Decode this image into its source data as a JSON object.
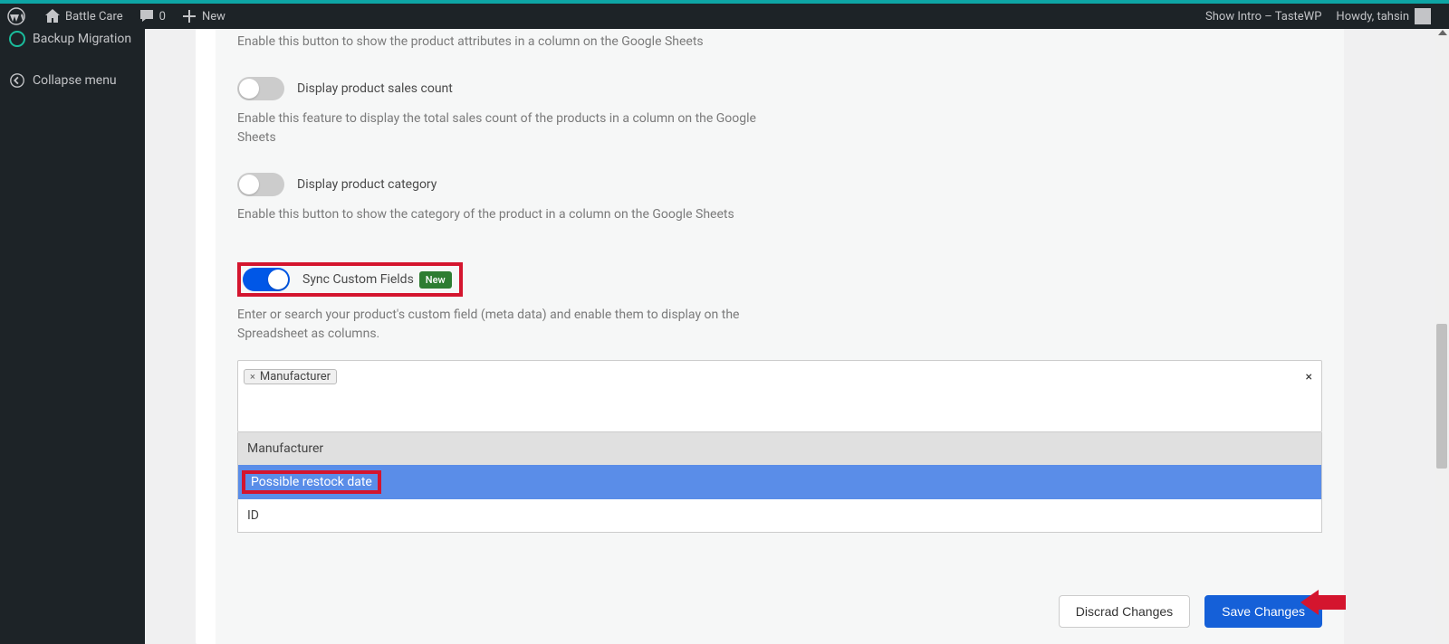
{
  "toolbar": {
    "site_name": "Battle Care",
    "comments_count": "0",
    "new_label": "New",
    "intro_link": "Show Intro – TasteWP",
    "howdy": "Howdy, tahsin"
  },
  "sidebar": {
    "backup_migration": "Backup Migration",
    "collapse": "Collapse menu"
  },
  "settings": {
    "attributes": {
      "desc": "Enable this button to show the product attributes in a column on the Google Sheets"
    },
    "sales_count": {
      "label": "Display product sales count",
      "desc": "Enable this feature to display the total sales count of the products in a column on the Google Sheets"
    },
    "category": {
      "label": "Display product category",
      "desc": "Enable this button to show the category of the product in a column on the Google Sheets"
    },
    "custom_fields": {
      "label": "Sync Custom Fields",
      "badge": "New",
      "desc": "Enter or search your product's custom field (meta data) and enable them to display on the Spreadsheet as columns."
    }
  },
  "multiselect": {
    "selected_tag": "Manufacturer",
    "options": [
      "Manufacturer",
      "Possible restock date",
      "ID"
    ]
  },
  "buttons": {
    "discard": "Discrad Changes",
    "save": "Save Changes"
  }
}
